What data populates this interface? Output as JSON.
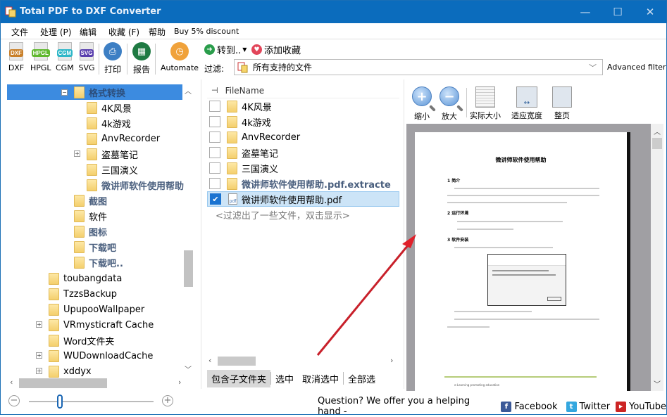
{
  "window": {
    "title": "Total PDF to DXF Converter",
    "controls": {
      "minimize": "—",
      "maximize": "☐",
      "close": "✕"
    }
  },
  "menu": [
    "文件",
    "处理 (P)",
    "编辑",
    "收藏 (F)",
    "帮助",
    "Buy 5% discount"
  ],
  "toolbar": {
    "formats": [
      {
        "label": "DXF",
        "badge": "DXF",
        "color": "#c9802a"
      },
      {
        "label": "HPGL",
        "badge": "HPGL",
        "color": "#5fb82e"
      },
      {
        "label": "CGM",
        "badge": "CGM",
        "color": "#2fb7c8"
      },
      {
        "label": "SVG",
        "badge": "SVG",
        "color": "#5a3fae"
      }
    ],
    "print": "打印",
    "report": "报告",
    "automate": "Automate",
    "goto": "转到..",
    "add_favorite": "添加收藏",
    "filter_label": "过滤:",
    "filter_value": "所有支持的文件",
    "advanced_filter": "Advanced filter"
  },
  "tree": {
    "selected": "格式转换",
    "children": [
      "4K风景",
      "4k游戏",
      "AnvRecorder",
      "盗墓笔记",
      "三国演义",
      "微讲师软件使用帮助"
    ],
    "siblings": [
      "截图",
      "软件",
      "图标",
      "下载吧",
      "下载吧.."
    ],
    "root_items": [
      "toubangdata",
      "TzzsBackup",
      "UpupooWallpaper",
      "VRmysticraft Cache",
      "Word文件夹",
      "WUDownloadCache",
      "xddyx"
    ]
  },
  "filelist": {
    "header": "FileName",
    "rows": [
      {
        "name": "4K风景",
        "type": "folder",
        "checked": false
      },
      {
        "name": "4k游戏",
        "type": "folder",
        "checked": false
      },
      {
        "name": "AnvRecorder",
        "type": "folder",
        "checked": false
      },
      {
        "name": "盗墓笔记",
        "type": "folder",
        "checked": false
      },
      {
        "name": "三国演义",
        "type": "folder",
        "checked": false
      },
      {
        "name": "微讲师软件使用帮助.pdf.extracte",
        "type": "folder",
        "checked": false
      },
      {
        "name": "微讲师软件使用帮助.pdf",
        "type": "pdf",
        "checked": true
      }
    ],
    "hint": "<过滤出了一些文件，双击显示>",
    "buttons": [
      "包含子文件夹",
      "选中",
      "取消选中",
      "全部选"
    ]
  },
  "preview": {
    "buttons": [
      "缩小",
      "放大",
      "实际大小",
      "适应宽度",
      "整页"
    ],
    "doc_title": "微讲师软件使用帮助",
    "sections": [
      "1  简介",
      "2  运行环境",
      "3  软件安装"
    ],
    "footer_text": "e-Learning promoting education"
  },
  "status": {
    "question": "Question? We offer you a helping hand -",
    "facebook": "Facebook",
    "twitter": "Twitter",
    "youtube": "YouTube"
  },
  "colors": {
    "titlebar": "#0b6cbd",
    "selection": "#3c8be0",
    "arrow": "#d0202a"
  }
}
